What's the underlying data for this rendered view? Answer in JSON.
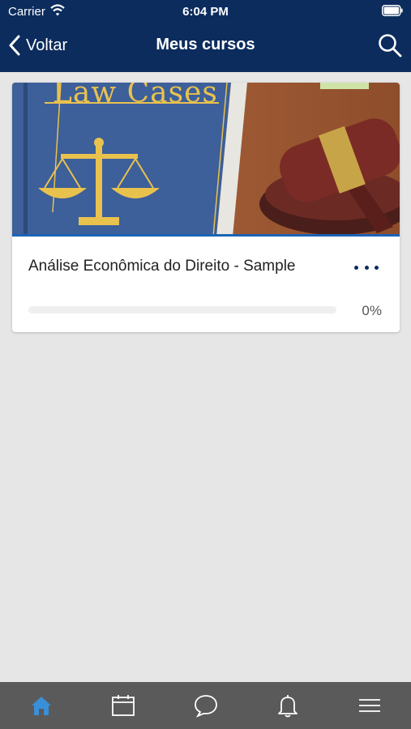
{
  "status_bar": {
    "carrier": "Carrier",
    "time": "6:04 PM"
  },
  "header": {
    "back_label": "Voltar",
    "title": "Meus cursos"
  },
  "course": {
    "image_text": "Law Cases",
    "title": "Análise Econômica do Direito - Sample",
    "progress": 0,
    "progress_label": "0%"
  },
  "tabs": [
    {
      "icon": "home-icon",
      "active": true
    },
    {
      "icon": "calendar-icon",
      "active": false
    },
    {
      "icon": "chat-icon",
      "active": false
    },
    {
      "icon": "bell-icon",
      "active": false
    },
    {
      "icon": "menu-icon",
      "active": false
    }
  ],
  "colors": {
    "header_bg": "#0c2c5e",
    "accent": "#1b63b7",
    "tab_active": "#3a8fd9",
    "tab_bar": "#5a5a5a",
    "page_bg": "#e6e6e6"
  }
}
